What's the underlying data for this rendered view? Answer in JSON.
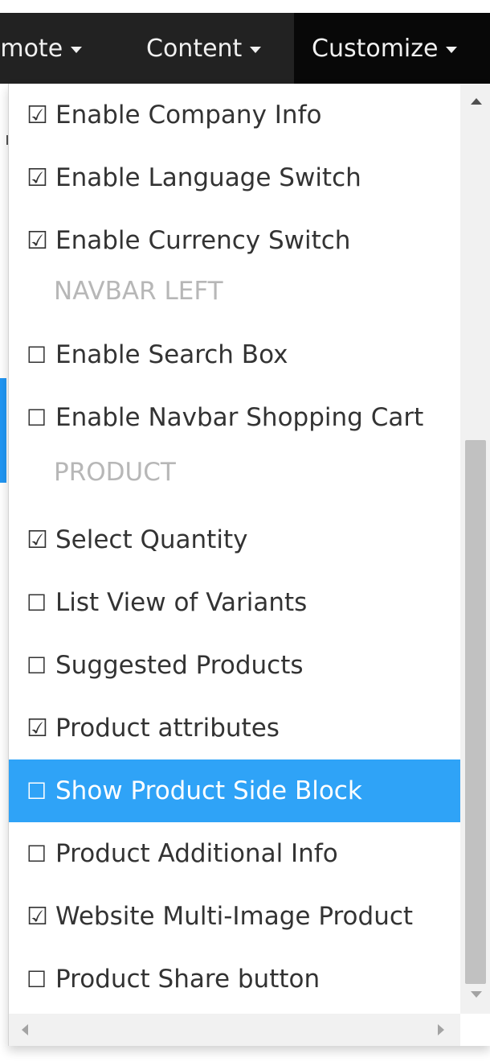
{
  "navbar": {
    "items": [
      {
        "label": "omote",
        "dropdown": true,
        "active": false
      },
      {
        "label": "Content",
        "dropdown": true,
        "active": false
      },
      {
        "label": "Customize",
        "dropdown": true,
        "active": true
      }
    ]
  },
  "menu": {
    "checked_glyph": "☑",
    "unchecked_glyph": "☐",
    "rows": [
      {
        "type": "option",
        "label": "Enable Company Info",
        "checked": true
      },
      {
        "type": "option",
        "label": "Enable Language Switch",
        "checked": true
      },
      {
        "type": "option",
        "label": "Enable Currency Switch",
        "checked": true
      },
      {
        "type": "header",
        "label": "NAVBAR LEFT"
      },
      {
        "type": "option",
        "label": "Enable Search Box",
        "checked": false
      },
      {
        "type": "option",
        "label": "Enable Navbar Shopping Cart",
        "checked": false
      },
      {
        "type": "header",
        "label": "PRODUCT"
      },
      {
        "type": "option",
        "label": "Select Quantity",
        "checked": true
      },
      {
        "type": "option",
        "label": "List View of Variants",
        "checked": false
      },
      {
        "type": "option",
        "label": "Suggested Products",
        "checked": false
      },
      {
        "type": "option",
        "label": "Product attributes",
        "checked": true
      },
      {
        "type": "option",
        "label": "Show Product Side Block",
        "checked": false,
        "highlighted": true
      },
      {
        "type": "option",
        "label": "Product Additional Info",
        "checked": false
      },
      {
        "type": "option",
        "label": "Website Multi-Image Product",
        "checked": true
      },
      {
        "type": "option",
        "label": "Product Share button",
        "checked": false
      }
    ]
  },
  "colors": {
    "navbar_bg": "#222222",
    "navbar_active_bg": "#080808",
    "highlight_bg": "#2fa3f7",
    "header_text": "#b7b7b7"
  }
}
